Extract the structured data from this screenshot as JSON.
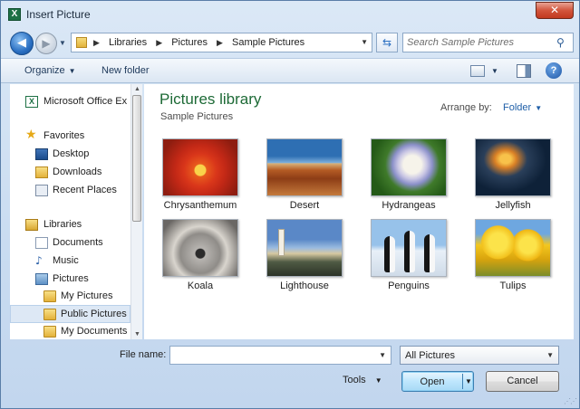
{
  "window": {
    "title": "Insert Picture",
    "app_icon": "excel-icon",
    "app_icon_glyph": "X",
    "close_glyph": "✕"
  },
  "address": {
    "back_glyph": "◀",
    "forward_glyph": "▶",
    "crumbs": [
      "Libraries",
      "Pictures",
      "Sample Pictures"
    ],
    "search_placeholder": "Search Sample Pictures"
  },
  "toolbar": {
    "organize": "Organize",
    "new_folder": "New folder",
    "help_glyph": "?"
  },
  "nav": {
    "items": [
      {
        "label": "Microsoft Office Ex",
        "icon": "excel-icon"
      },
      {
        "label": "Favorites",
        "icon": "star-icon"
      },
      {
        "label": "Desktop",
        "icon": "desktop-icon"
      },
      {
        "label": "Downloads",
        "icon": "downloads-icon"
      },
      {
        "label": "Recent Places",
        "icon": "recent-places-icon"
      },
      {
        "label": "Libraries",
        "icon": "libraries-icon"
      },
      {
        "label": "Documents",
        "icon": "documents-icon"
      },
      {
        "label": "Music",
        "icon": "music-icon"
      },
      {
        "label": "Pictures",
        "icon": "pictures-icon"
      },
      {
        "label": "My Pictures",
        "icon": "folder-icon"
      },
      {
        "label": "Public Pictures",
        "icon": "folder-icon",
        "selected": true
      },
      {
        "label": "My Documents",
        "icon": "folder-icon"
      }
    ]
  },
  "library": {
    "title": "Pictures library",
    "subtitle": "Sample Pictures",
    "arrange_label": "Arrange by:",
    "arrange_value": "Folder"
  },
  "pictures": [
    {
      "name": "Chrysanthemum"
    },
    {
      "name": "Desert"
    },
    {
      "name": "Hydrangeas"
    },
    {
      "name": "Jellyfish"
    },
    {
      "name": "Koala"
    },
    {
      "name": "Lighthouse"
    },
    {
      "name": "Penguins"
    },
    {
      "name": "Tulips"
    }
  ],
  "footer": {
    "file_name_label": "File name:",
    "file_name_value": "",
    "filter_value": "All Pictures",
    "tools_label": "Tools",
    "open_label": "Open",
    "cancel_label": "Cancel"
  },
  "colors": {
    "library_title": "#1d6a36",
    "accent_blue": "#1f5fa8",
    "close_button": "#c1391f"
  }
}
